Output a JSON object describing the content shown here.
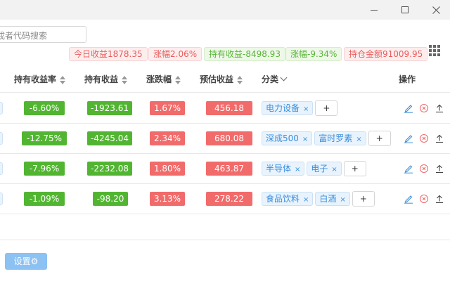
{
  "window": {
    "minimize_icon": "minimize-icon",
    "maximize_icon": "maximize-icon",
    "close_icon": "close-icon"
  },
  "search": {
    "placeholder": "戎者代码搜索"
  },
  "stats": [
    {
      "label": "今日收益1878.35",
      "color": "red"
    },
    {
      "label": "涨幅2.06%",
      "color": "red"
    },
    {
      "label": "持有收益-8498.93",
      "color": "green"
    },
    {
      "label": "涨幅-9.34%",
      "color": "green"
    },
    {
      "label": "持仓金额91009.95",
      "color": "red"
    }
  ],
  "table": {
    "headers": {
      "hold_rate": "持有收益率",
      "hold_profit": "持有收益",
      "change": "涨跌幅",
      "estimate": "预估收益",
      "category": "分类",
      "actions": "操作"
    },
    "rows": [
      {
        "hold_rate": "-6.60%",
        "hold_profit": "-1923.61",
        "change": "1.67%",
        "estimate": "456.18",
        "tags": [
          "电力设备"
        ]
      },
      {
        "hold_rate": "-12.75%",
        "hold_profit": "-4245.04",
        "change": "2.34%",
        "estimate": "680.08",
        "tags": [
          "深成500",
          "富时罗素"
        ]
      },
      {
        "hold_rate": "-7.96%",
        "hold_profit": "-2232.08",
        "change": "1.80%",
        "estimate": "463.87",
        "tags": [
          "半导体",
          "电子"
        ]
      },
      {
        "hold_rate": "-1.09%",
        "hold_profit": "-98.20",
        "change": "3.13%",
        "estimate": "278.22",
        "tags": [
          "食品饮料",
          "白酒"
        ]
      }
    ],
    "add_label": "+",
    "tag_close": "×"
  },
  "footer": {
    "settings_label": "设置⚙"
  },
  "colors": {
    "green": "#52b532",
    "red": "#f16b6b",
    "tag_blue": "#3b8edb",
    "settings_bg": "#8cc1f3"
  }
}
